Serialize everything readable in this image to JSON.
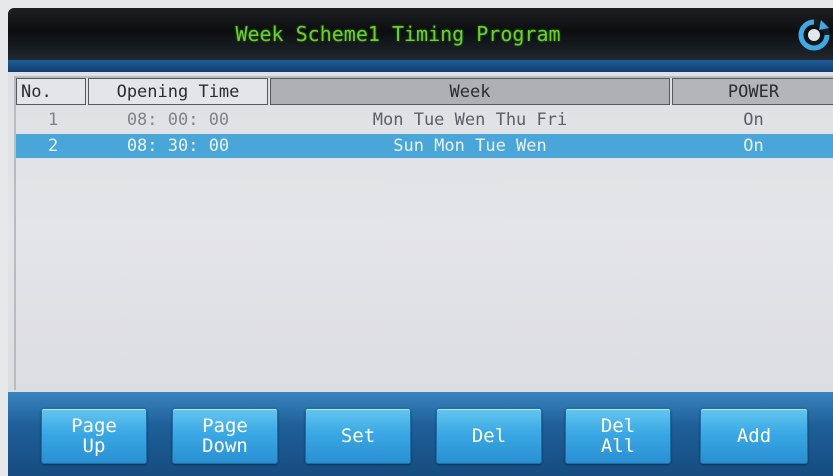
{
  "title": "Week Scheme1 Timing Program",
  "table": {
    "headers": {
      "no": "No.",
      "opening_time": "Opening Time",
      "week": "Week",
      "power": "POWER"
    },
    "rows": [
      {
        "no": "1",
        "time": "08: 00: 00",
        "week": "Mon Tue Wen Thu Fri",
        "power": "On",
        "selected": false
      },
      {
        "no": "2",
        "time": "08: 30: 00",
        "week": "Sun Mon Tue Wen",
        "power": "On",
        "selected": true
      }
    ]
  },
  "toolbar": {
    "page_up": "Page\nUp",
    "page_down": "Page\nDown",
    "set": "Set",
    "del": "Del",
    "del_all": "Del\nAll",
    "add": "Add"
  },
  "icons": {
    "refresh": "refresh-icon"
  },
  "colors": {
    "title_text": "#6ccf2b",
    "selected_row": "#4aa6d8",
    "button": "#3aa8e4",
    "toolbar": "#1f5f99"
  }
}
